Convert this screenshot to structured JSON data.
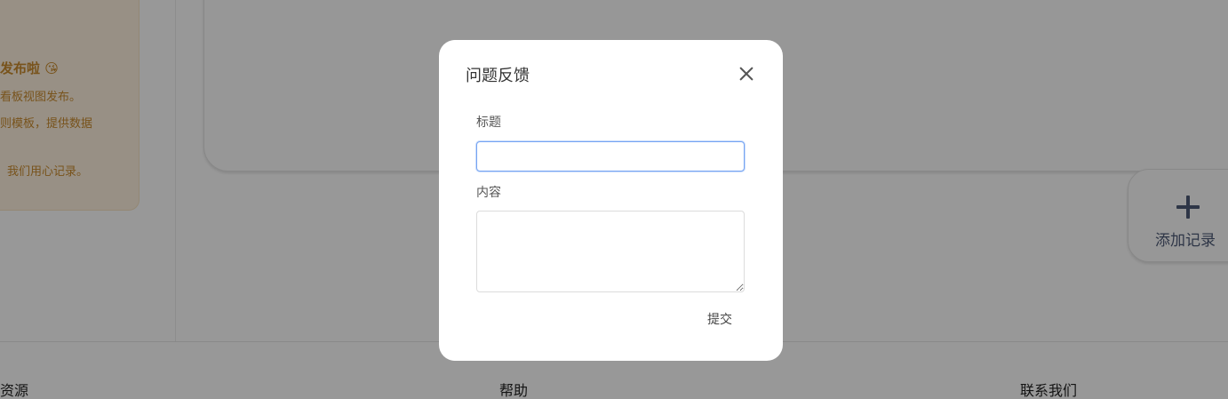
{
  "announcement": {
    "title": "发布啦 😘",
    "lines": [
      "看板视图发布。",
      "则模板，提供数据",
      "我们用心记录。"
    ]
  },
  "add_record": {
    "label": "添加记录"
  },
  "footer": {
    "headings": [
      "资源",
      "帮助",
      "联系我们"
    ]
  },
  "modal": {
    "title": "问题反馈",
    "title_field": {
      "label": "标题",
      "value": "",
      "placeholder": ""
    },
    "content_field": {
      "label": "内容",
      "value": "",
      "placeholder": ""
    },
    "submit_label": "提交"
  },
  "colors": {
    "accent_orange": "#c98a2e",
    "add_icon": "#4e5a77",
    "focus_border": "#76a4f2"
  },
  "icons": {
    "close": "close-icon",
    "add": "plus-icon"
  }
}
